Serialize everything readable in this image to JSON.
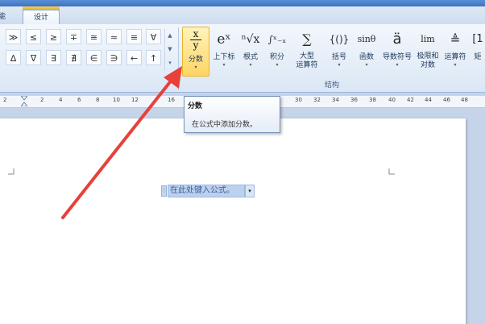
{
  "window": {
    "title": ""
  },
  "tabs": [
    {
      "label": "能"
    },
    {
      "label": "设计"
    }
  ],
  "symbols": {
    "row1": [
      "≫",
      "≤",
      "≥",
      "∓",
      "≅",
      "≈",
      "≡",
      "∀"
    ],
    "row2": [
      "∆",
      "∇",
      "∃",
      "∄",
      "∈",
      "∋",
      "←",
      "↑"
    ],
    "scroll": [
      "▲",
      "▼",
      "▾"
    ]
  },
  "structures": [
    {
      "label": "分数",
      "label2": "",
      "icon": "fraction-icon"
    },
    {
      "label": "上下标",
      "label2": "",
      "icon": "script-icon",
      "glyph": "eˣ"
    },
    {
      "label": "根式",
      "label2": "",
      "icon": "radical-icon",
      "glyph": "ⁿ√x"
    },
    {
      "label": "积分",
      "label2": "",
      "icon": "integral-icon",
      "glyph": "∫ˣ₋ₓ"
    },
    {
      "label": "大型",
      "label2": "运算符",
      "icon": "large-operator-icon",
      "glyph": "∑"
    },
    {
      "label": "括号",
      "label2": "",
      "icon": "bracket-icon",
      "glyph": "{()}"
    },
    {
      "label": "函数",
      "label2": "",
      "icon": "function-icon",
      "glyph": "sinθ"
    },
    {
      "label": "导数符号",
      "label2": "",
      "icon": "accent-icon",
      "glyph": "ä"
    },
    {
      "label": "极限和",
      "label2": "对数",
      "icon": "limit-icon",
      "glyph": "lim"
    },
    {
      "label": "运算符",
      "label2": "",
      "icon": "operator-icon",
      "glyph": "≜"
    },
    {
      "label": "矩",
      "label2": "",
      "icon": "matrix-icon",
      "glyph": "[1"
    }
  ],
  "fraction_icon": {
    "numerator": "x",
    "denominator": "y"
  },
  "group_label": "结构",
  "ruler": {
    "left_numbers": [
      "2",
      "2",
      "4",
      "6",
      "8",
      "10",
      "12"
    ],
    "right_numbers": [
      "16",
      "30",
      "32",
      "34",
      "36",
      "38",
      "40",
      "42",
      "44",
      "46",
      "48"
    ]
  },
  "tooltip": {
    "title": "分数",
    "body": "在公式中添加分数。"
  },
  "equation": {
    "placeholder": "在此处键入公式。",
    "handle": "⋮",
    "dropdown": "▾"
  },
  "colors": {
    "accent": "#ffd564",
    "arrow": "#e8403a",
    "ribbon": "#dbe7f5"
  }
}
